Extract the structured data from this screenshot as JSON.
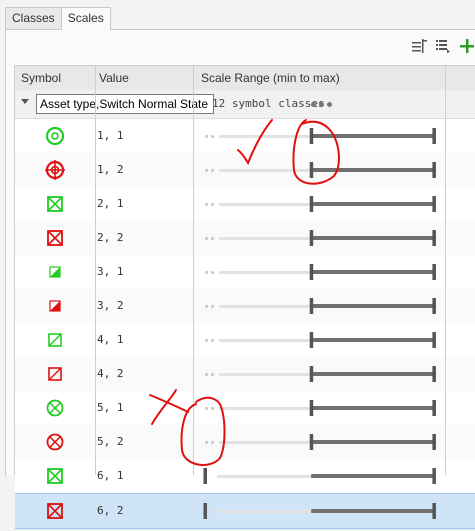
{
  "tabs": [
    {
      "label": "Classes",
      "active": false
    },
    {
      "label": "Scales",
      "active": true
    }
  ],
  "columns": {
    "symbol": "Symbol",
    "value": "Value",
    "range": "Scale Range (min to max)"
  },
  "group": {
    "field": "Asset type,Switch Normal State",
    "count": "12 symbol classes"
  },
  "colors": {
    "green": "#22cc22",
    "red": "#e01010",
    "annotation": "#e01010",
    "selected": "#cfe4f7"
  },
  "rows": [
    {
      "value": "1, 1",
      "icon": "circle-target-green-icon",
      "min": 0.45,
      "max": 0.97
    },
    {
      "value": "1, 2",
      "icon": "circle-crosshair-red-icon",
      "min": 0.45,
      "max": 0.97
    },
    {
      "value": "2, 1",
      "icon": "box-x-green-icon",
      "min": 0.45,
      "max": 0.97
    },
    {
      "value": "2, 2",
      "icon": "box-x-red-icon",
      "min": 0.45,
      "max": 0.97
    },
    {
      "value": "3, 1",
      "icon": "half-triangle-green-icon",
      "min": 0.45,
      "max": 0.97
    },
    {
      "value": "3, 2",
      "icon": "half-triangle-red-icon",
      "min": 0.45,
      "max": 0.97
    },
    {
      "value": "4, 1",
      "icon": "box-slash-green-icon",
      "min": 0.45,
      "max": 0.97
    },
    {
      "value": "4, 2",
      "icon": "box-slash-red-icon",
      "min": 0.45,
      "max": 0.97
    },
    {
      "value": "5, 1",
      "icon": "circle-x-green-icon",
      "min": 0.45,
      "max": 0.97
    },
    {
      "value": "5, 2",
      "icon": "circle-x-red-icon",
      "min": 0.45,
      "max": 0.97
    },
    {
      "value": "6, 1",
      "icon": "box-x-green-icon",
      "min": 0.0,
      "max": 0.97
    },
    {
      "value": "6, 2",
      "icon": "box-x-red-icon",
      "min": 0.0,
      "max": 0.97,
      "selected": true
    }
  ]
}
